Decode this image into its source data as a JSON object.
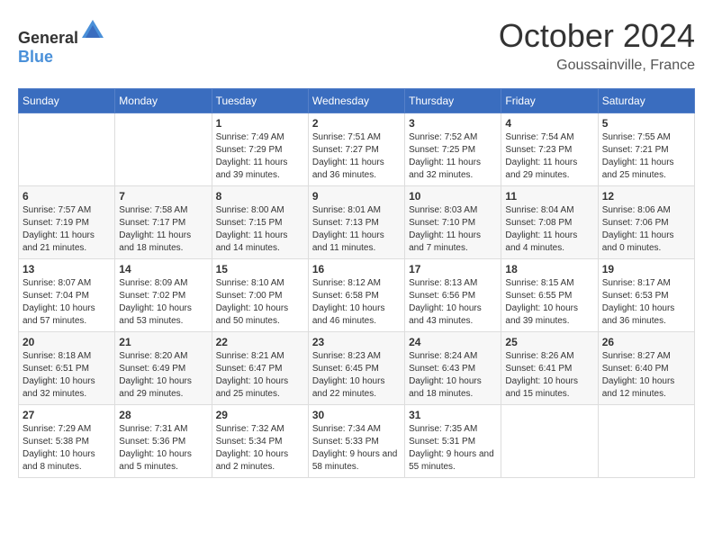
{
  "header": {
    "logo_general": "General",
    "logo_blue": "Blue",
    "month_title": "October 2024",
    "location": "Goussainville, France"
  },
  "calendar": {
    "days_of_week": [
      "Sunday",
      "Monday",
      "Tuesday",
      "Wednesday",
      "Thursday",
      "Friday",
      "Saturday"
    ],
    "weeks": [
      [
        {
          "day": "",
          "content": ""
        },
        {
          "day": "",
          "content": ""
        },
        {
          "day": "1",
          "content": "Sunrise: 7:49 AM\nSunset: 7:29 PM\nDaylight: 11 hours and 39 minutes."
        },
        {
          "day": "2",
          "content": "Sunrise: 7:51 AM\nSunset: 7:27 PM\nDaylight: 11 hours and 36 minutes."
        },
        {
          "day": "3",
          "content": "Sunrise: 7:52 AM\nSunset: 7:25 PM\nDaylight: 11 hours and 32 minutes."
        },
        {
          "day": "4",
          "content": "Sunrise: 7:54 AM\nSunset: 7:23 PM\nDaylight: 11 hours and 29 minutes."
        },
        {
          "day": "5",
          "content": "Sunrise: 7:55 AM\nSunset: 7:21 PM\nDaylight: 11 hours and 25 minutes."
        }
      ],
      [
        {
          "day": "6",
          "content": "Sunrise: 7:57 AM\nSunset: 7:19 PM\nDaylight: 11 hours and 21 minutes."
        },
        {
          "day": "7",
          "content": "Sunrise: 7:58 AM\nSunset: 7:17 PM\nDaylight: 11 hours and 18 minutes."
        },
        {
          "day": "8",
          "content": "Sunrise: 8:00 AM\nSunset: 7:15 PM\nDaylight: 11 hours and 14 minutes."
        },
        {
          "day": "9",
          "content": "Sunrise: 8:01 AM\nSunset: 7:13 PM\nDaylight: 11 hours and 11 minutes."
        },
        {
          "day": "10",
          "content": "Sunrise: 8:03 AM\nSunset: 7:10 PM\nDaylight: 11 hours and 7 minutes."
        },
        {
          "day": "11",
          "content": "Sunrise: 8:04 AM\nSunset: 7:08 PM\nDaylight: 11 hours and 4 minutes."
        },
        {
          "day": "12",
          "content": "Sunrise: 8:06 AM\nSunset: 7:06 PM\nDaylight: 11 hours and 0 minutes."
        }
      ],
      [
        {
          "day": "13",
          "content": "Sunrise: 8:07 AM\nSunset: 7:04 PM\nDaylight: 10 hours and 57 minutes."
        },
        {
          "day": "14",
          "content": "Sunrise: 8:09 AM\nSunset: 7:02 PM\nDaylight: 10 hours and 53 minutes."
        },
        {
          "day": "15",
          "content": "Sunrise: 8:10 AM\nSunset: 7:00 PM\nDaylight: 10 hours and 50 minutes."
        },
        {
          "day": "16",
          "content": "Sunrise: 8:12 AM\nSunset: 6:58 PM\nDaylight: 10 hours and 46 minutes."
        },
        {
          "day": "17",
          "content": "Sunrise: 8:13 AM\nSunset: 6:56 PM\nDaylight: 10 hours and 43 minutes."
        },
        {
          "day": "18",
          "content": "Sunrise: 8:15 AM\nSunset: 6:55 PM\nDaylight: 10 hours and 39 minutes."
        },
        {
          "day": "19",
          "content": "Sunrise: 8:17 AM\nSunset: 6:53 PM\nDaylight: 10 hours and 36 minutes."
        }
      ],
      [
        {
          "day": "20",
          "content": "Sunrise: 8:18 AM\nSunset: 6:51 PM\nDaylight: 10 hours and 32 minutes."
        },
        {
          "day": "21",
          "content": "Sunrise: 8:20 AM\nSunset: 6:49 PM\nDaylight: 10 hours and 29 minutes."
        },
        {
          "day": "22",
          "content": "Sunrise: 8:21 AM\nSunset: 6:47 PM\nDaylight: 10 hours and 25 minutes."
        },
        {
          "day": "23",
          "content": "Sunrise: 8:23 AM\nSunset: 6:45 PM\nDaylight: 10 hours and 22 minutes."
        },
        {
          "day": "24",
          "content": "Sunrise: 8:24 AM\nSunset: 6:43 PM\nDaylight: 10 hours and 18 minutes."
        },
        {
          "day": "25",
          "content": "Sunrise: 8:26 AM\nSunset: 6:41 PM\nDaylight: 10 hours and 15 minutes."
        },
        {
          "day": "26",
          "content": "Sunrise: 8:27 AM\nSunset: 6:40 PM\nDaylight: 10 hours and 12 minutes."
        }
      ],
      [
        {
          "day": "27",
          "content": "Sunrise: 7:29 AM\nSunset: 5:38 PM\nDaylight: 10 hours and 8 minutes."
        },
        {
          "day": "28",
          "content": "Sunrise: 7:31 AM\nSunset: 5:36 PM\nDaylight: 10 hours and 5 minutes."
        },
        {
          "day": "29",
          "content": "Sunrise: 7:32 AM\nSunset: 5:34 PM\nDaylight: 10 hours and 2 minutes."
        },
        {
          "day": "30",
          "content": "Sunrise: 7:34 AM\nSunset: 5:33 PM\nDaylight: 9 hours and 58 minutes."
        },
        {
          "day": "31",
          "content": "Sunrise: 7:35 AM\nSunset: 5:31 PM\nDaylight: 9 hours and 55 minutes."
        },
        {
          "day": "",
          "content": ""
        },
        {
          "day": "",
          "content": ""
        }
      ]
    ]
  }
}
